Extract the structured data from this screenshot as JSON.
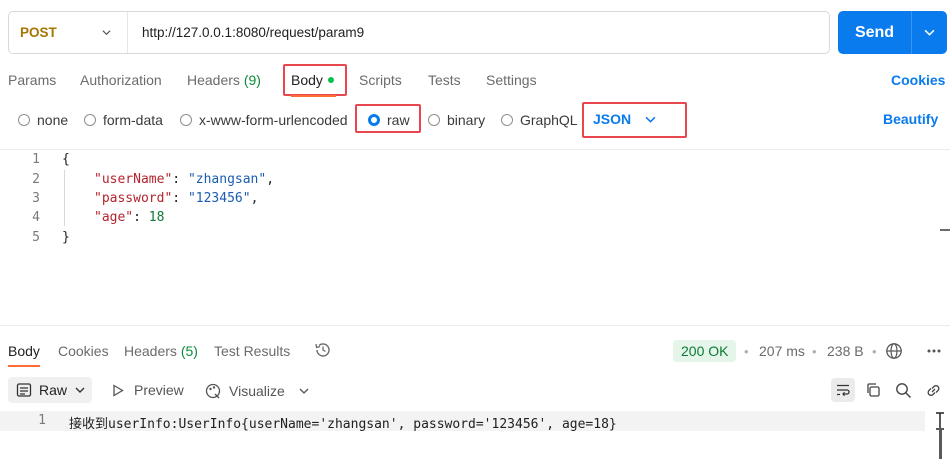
{
  "request": {
    "method": "POST",
    "url": "http://127.0.0.1:8080/request/param9",
    "send_label": "Send"
  },
  "request_tabs": [
    {
      "label": "Params",
      "count": ""
    },
    {
      "label": "Authorization",
      "count": ""
    },
    {
      "label": "Headers",
      "count": "(9)"
    },
    {
      "label": "Body",
      "count": ""
    },
    {
      "label": "Scripts",
      "count": ""
    },
    {
      "label": "Tests",
      "count": ""
    },
    {
      "label": "Settings",
      "count": ""
    }
  ],
  "cookies_label": "Cookies",
  "body_types": [
    "none",
    "form-data",
    "x-www-form-urlencoded",
    "raw",
    "binary",
    "GraphQL"
  ],
  "body_type_selected": "raw",
  "format_select": "JSON",
  "beautify_label": "Beautify",
  "editor": {
    "line_numbers": [
      "1",
      "2",
      "3",
      "4",
      "5"
    ],
    "open_brace": "{",
    "close_brace": "}",
    "fields": [
      {
        "key": "\"userName\"",
        "sep": ": ",
        "value": "\"zhangsan\"",
        "tail": ",",
        "type": "string"
      },
      {
        "key": "\"password\"",
        "sep": ": ",
        "value": "\"123456\"",
        "tail": ",",
        "type": "string"
      },
      {
        "key": "\"age\"",
        "sep": ": ",
        "value": "18",
        "tail": "",
        "type": "number"
      }
    ]
  },
  "response": {
    "tabs": [
      {
        "label": "Body",
        "count": ""
      },
      {
        "label": "Cookies",
        "count": ""
      },
      {
        "label": "Headers",
        "count": "(5)"
      },
      {
        "label": "Test Results",
        "count": ""
      }
    ],
    "status": "200 OK",
    "time": "207 ms",
    "size": "238 B",
    "view_mode": "Raw",
    "preview_label": "Preview",
    "visualize_label": "Visualize",
    "line_number": "1",
    "body_text": "接收到userInfo:UserInfo{userName='zhangsan', password='123456', age=18}"
  },
  "colors": {
    "accent": "#097bed",
    "active_tab_underline": "#ff6c37",
    "highlight_box": "#e8474f",
    "status_ok": "#0d7a35"
  }
}
